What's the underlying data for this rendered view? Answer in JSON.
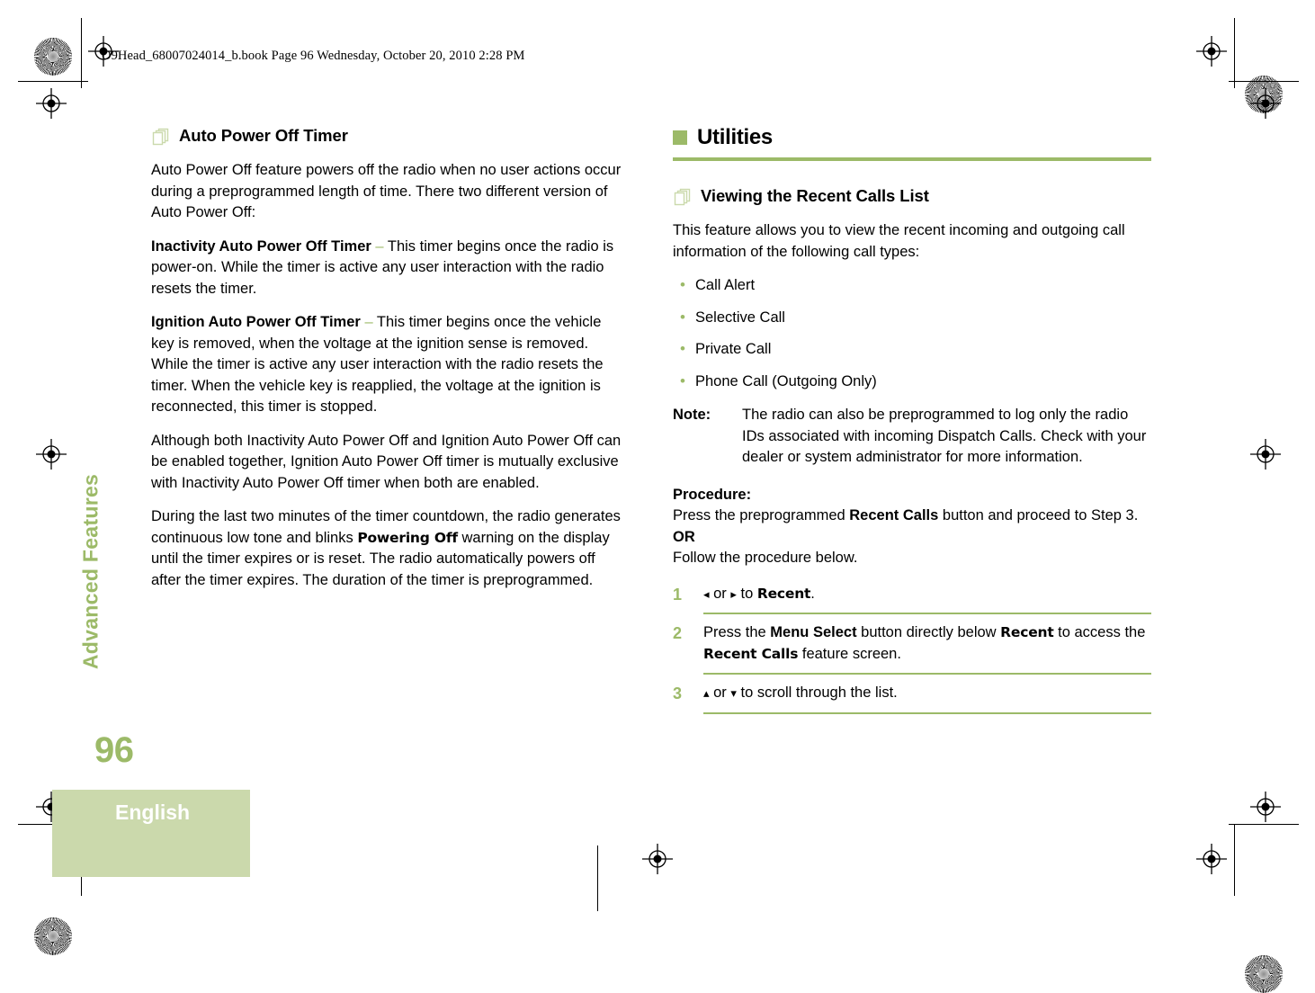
{
  "page": {
    "slug": "O9Head_68007024014_b.book  Page 96  Wednesday, October 20, 2010  2:28 PM",
    "side_tab": "Advanced Features",
    "page_number": "96",
    "language": "English",
    "accent_color": "#9CBA68",
    "accent_light": "#CBD9AC"
  },
  "left_column": {
    "heading": "Auto Power Off Timer",
    "heading_icon": "page-stack-icon",
    "paragraphs": {
      "intro": "Auto Power Off feature powers off the radio when no user actions occur during a preprogrammed length of time. There two different version of Auto Power Off:",
      "inactivity_term": "Inactivity Auto Power Off Timer",
      "inactivity_dash": "–",
      "inactivity_text": " This timer begins once the radio is power-on. While the timer is active any user interaction with the radio resets the timer.",
      "ignition_term": "Ignition Auto Power Off Timer",
      "ignition_dash": "–",
      "ignition_text": " This timer begins once the vehicle key is removed, when the voltage at the ignition sense is removed. While the timer is active any user interaction with the radio resets the timer. When the vehicle key is reapplied, the voltage at the ignition is reconnected, this timer is stopped.",
      "mutual": "Although both Inactivity Auto Power Off and Ignition Auto Power Off can be enabled together, Ignition Auto Power Off timer is mutually exclusive with Inactivity Auto Power Off timer when both are enabled.",
      "countdown_pre": "During the last two minutes of the timer countdown, the radio generates continuous low tone and blinks ",
      "countdown_display": "Powering Off",
      "countdown_post": " warning on the display until the timer expires or is reset. The radio automatically powers off after the timer expires. The duration of the timer is preprogrammed."
    }
  },
  "right_column": {
    "section_heading": "Utilities",
    "feature_heading": "Viewing the Recent Calls List",
    "feature_icon": "page-stack-icon",
    "intro": "This feature allows you to view the recent incoming and outgoing call information of the following call types:",
    "call_types": [
      "Call Alert",
      "Selective Call",
      "Private Call",
      "Phone Call (Outgoing Only)"
    ],
    "note": {
      "label": "Note:",
      "text": "The radio can also be preprogrammed to log only the radio IDs associated with incoming Dispatch Calls. Check with your dealer or system administrator for more information."
    },
    "procedure": {
      "label": "Procedure:",
      "line1_pre": "Press the preprogrammed ",
      "line1_bold": "Recent Calls",
      "line1_post": " button and proceed to Step 3.",
      "or": "OR",
      "line2": "Follow the procedure below."
    },
    "steps": [
      {
        "number": "1",
        "left_arrow": "◂",
        "or": " or ",
        "right_arrow": "▸",
        "mid": " to ",
        "display": "Recent",
        "tail": "."
      },
      {
        "number": "2",
        "pre": "Press the ",
        "bold": "Menu Select",
        "mid": " button directly below ",
        "display": "Recent",
        "mid2": " to access the ",
        "display2": "Recent Calls",
        "tail": " feature screen."
      },
      {
        "number": "3",
        "up_arrow": "▴",
        "or": " or ",
        "down_arrow": "▾",
        "tail": " to scroll through the list."
      }
    ]
  }
}
